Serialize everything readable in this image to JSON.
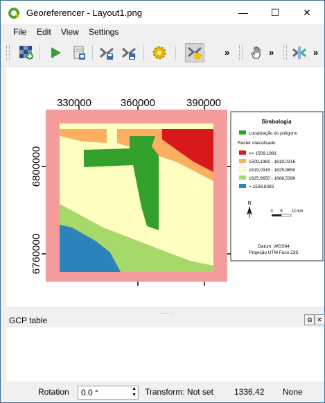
{
  "window": {
    "title": "Georeferencer - Layout1.png",
    "minimize_glyph": "—",
    "maximize_glyph": "☐",
    "close_glyph": "✕"
  },
  "menu": [
    "File",
    "Edit",
    "View",
    "Settings"
  ],
  "toolbar": {
    "overflow_glyph": "»",
    "icons": [
      "open-raster-icon",
      "start-georeferencing-icon",
      "generate-gdal-script-icon",
      "load-gcp-points-icon",
      "save-gcp-points-icon",
      "transformation-settings-icon",
      "add-point-icon",
      "pan-icon",
      "link-georeferencer-icon"
    ]
  },
  "map": {
    "x_ticks": [
      "330000",
      "360000",
      "390000"
    ],
    "y_ticks": [
      "6800000",
      "6760000"
    ],
    "legend": {
      "title": "Simbologia",
      "polygon_label": "Localização do polígono",
      "raster_title": "Raster classificado",
      "classes": [
        {
          "label": "<= 1509,1981",
          "color": "#d7191c"
        },
        {
          "label": "1509,1981 - 1619,0316",
          "color": "#fdae61"
        },
        {
          "label": "1619,0316 - 1625,9650",
          "color": "#ffffc0"
        },
        {
          "label": "1625,9650 - 1688,5390",
          "color": "#a6d96a"
        },
        {
          "label": "> 1528,8392",
          "color": "#2b83ba"
        }
      ],
      "polygon_color": "#33a02c",
      "frame_color": "#f49b9b",
      "scale_labels": [
        "0",
        "5",
        "10 km"
      ],
      "north_label": "N",
      "datum": "Datum: WGS84",
      "projection": "Projeção UTM Fuso 23S"
    }
  },
  "gcp_panel": {
    "title": "GCP table",
    "float_glyph": "⧉",
    "close_glyph": "✕"
  },
  "statusbar": {
    "rotation_label": "Rotation",
    "rotation_value": "0.0 °",
    "transform_text": "Transform: Not set",
    "coords": "1336,42",
    "crs": "None"
  }
}
